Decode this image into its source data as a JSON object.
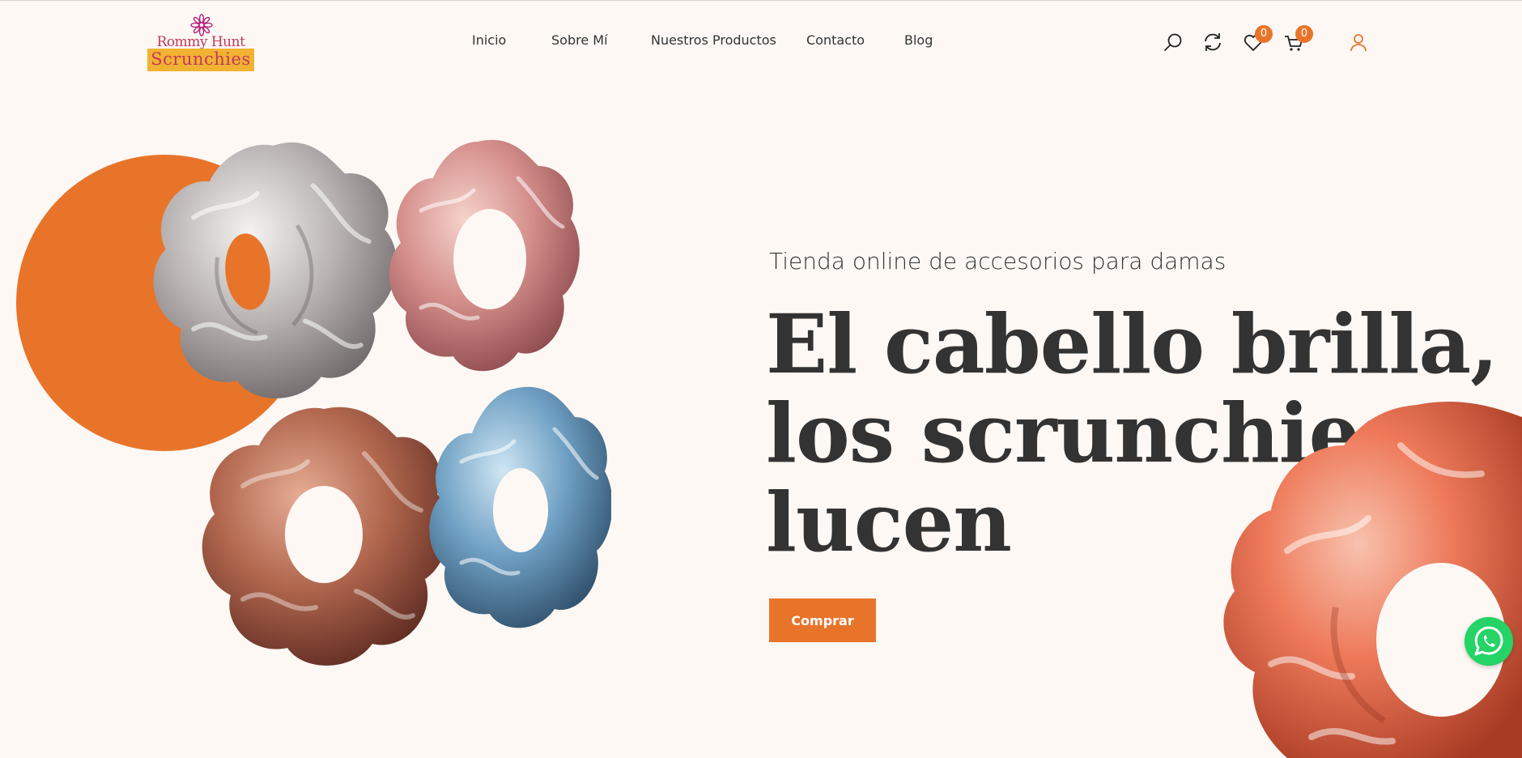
{
  "brand": {
    "line1": "Rommy Hunt",
    "line2": "Scrunchies",
    "primary_color": "#e8742a",
    "logo_band_color": "#f2b232",
    "logo_text_color": "#c2385a"
  },
  "nav": {
    "items": [
      {
        "label": "Inicio"
      },
      {
        "label": "Sobre Mí"
      },
      {
        "label": "Nuestros Productos"
      },
      {
        "label": "Contacto"
      },
      {
        "label": "Blog"
      }
    ]
  },
  "header_icons": {
    "search": "search-icon",
    "compare": "refresh-icon",
    "wishlist": "heart-icon",
    "wishlist_count": "0",
    "cart": "cart-icon",
    "cart_count": "0",
    "account": "user-icon"
  },
  "hero": {
    "subtitle": "Tienda online de accesorios para damas",
    "headline_lines": [
      "El cabello brilla,",
      "los scrunchies",
      "lucen"
    ],
    "cta_label": "Comprar"
  },
  "floating": {
    "whatsapp": "whatsapp-icon"
  }
}
